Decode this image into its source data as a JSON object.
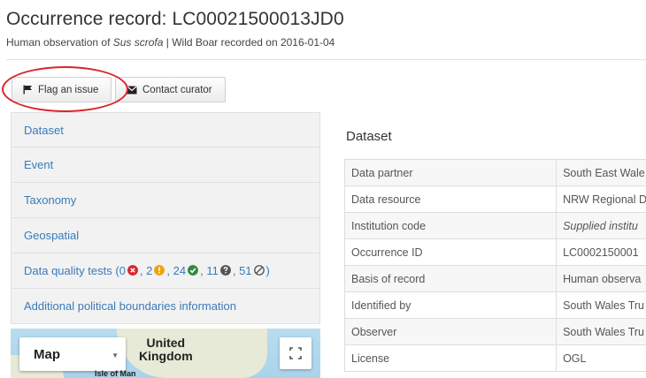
{
  "header": {
    "title": "Occurrence record: LC00021500013JD0",
    "subtitle_prefix": "Human observation of ",
    "subtitle_species": "Sus scrofa",
    "subtitle_suffix": " | Wild Boar recorded on 2016-01-04"
  },
  "actions": {
    "flag_label": "Flag an issue",
    "contact_label": "Contact curator"
  },
  "sections": [
    {
      "label": "Dataset"
    },
    {
      "label": "Event"
    },
    {
      "label": "Taxonomy"
    },
    {
      "label": "Geospatial"
    },
    {
      "label": "Additional political boundaries information"
    }
  ],
  "data_quality": {
    "label": "Data quality tests",
    "open": "(",
    "failed": "0",
    "warnings": "2",
    "passed": "24",
    "missing": "11",
    "not_tested": "51",
    "close": ")",
    "colors": {
      "failed": "#d9262c",
      "warnings": "#f0a30a",
      "passed": "#2e8b3e",
      "missing": "#555555",
      "not_tested": "#555555"
    }
  },
  "map": {
    "type_selected": "Map",
    "label_uk": "United\nKingdom",
    "label_iom": "Isle of Man"
  },
  "dataset": {
    "heading": "Dataset",
    "rows": [
      {
        "label": "Data partner",
        "value": "South East Wale"
      },
      {
        "label": "Data resource",
        "value": "NRW Regional D"
      },
      {
        "label": "Institution code",
        "value": "Supplied institu"
      },
      {
        "label": "Occurrence ID",
        "value": "LC0002150001"
      },
      {
        "label": "Basis of record",
        "value": "Human observa"
      },
      {
        "label": "Identified by",
        "value": "South Wales Tru"
      },
      {
        "label": "Observer",
        "value": "South Wales Tru"
      },
      {
        "label": "License",
        "value": "OGL"
      }
    ]
  }
}
